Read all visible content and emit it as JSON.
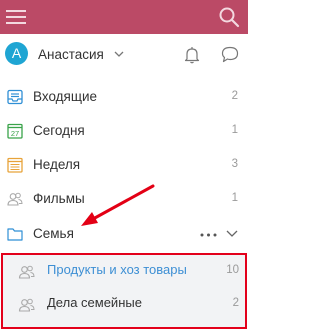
{
  "user": {
    "avatar_letter": "A",
    "name": "Анастасия"
  },
  "nav": {
    "inbox": {
      "label": "Входящие",
      "count": "2"
    },
    "today": {
      "label": "Сегодня",
      "count": "1",
      "icon_number": "27"
    },
    "week": {
      "label": "Неделя",
      "count": "3"
    },
    "films": {
      "label": "Фильмы",
      "count": "1"
    },
    "family": {
      "label": "Семья"
    }
  },
  "family_lists": [
    {
      "label": "Продукты и хоз товары",
      "count": "10"
    },
    {
      "label": "Дела семейные",
      "count": "2"
    }
  ],
  "colors": {
    "topbar": "#bb4a66",
    "accent_blue": "#3d8fd4",
    "highlight_border": "#e3001b",
    "arrow": "#e30015"
  }
}
